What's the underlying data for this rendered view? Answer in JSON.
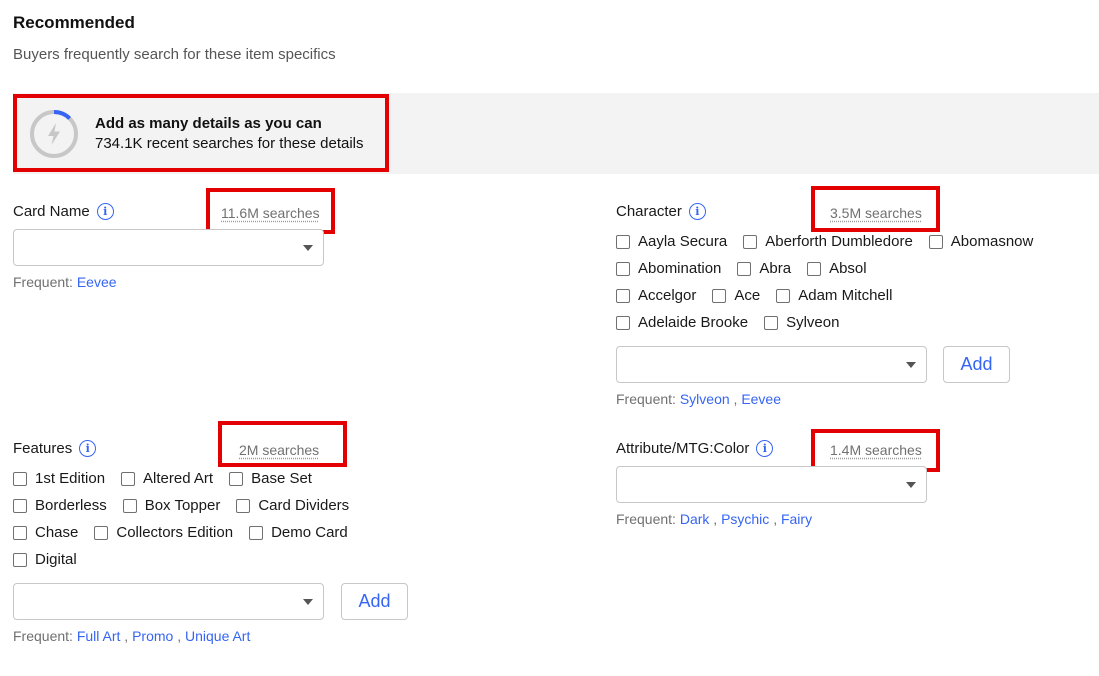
{
  "header": {
    "title": "Recommended",
    "subtitle": "Buyers frequently search for these item specifics"
  },
  "banner": {
    "heading": "Add as many details as you can",
    "subtext": "734.1K recent searches for these details",
    "icon": "lightning-gauge-icon",
    "progress": 0.12
  },
  "card_name": {
    "label": "Card Name",
    "searches": "11.6M searches",
    "frequent_label": "Frequent:",
    "frequent": [
      "Eevee"
    ]
  },
  "character": {
    "label": "Character",
    "searches": "3.5M searches",
    "rows": [
      [
        "Aayla Secura",
        "Aberforth Dumbledore",
        "Abomasnow"
      ],
      [
        "Abomination",
        "Abra",
        "Absol"
      ],
      [
        "Accelgor",
        "Ace",
        "Adam Mitchell"
      ],
      [
        "Adelaide Brooke",
        "Sylveon"
      ]
    ],
    "add_label": "Add",
    "frequent_label": "Frequent:",
    "frequent": [
      "Sylveon",
      "Eevee"
    ]
  },
  "features": {
    "label": "Features",
    "searches": "2M searches",
    "rows": [
      [
        "1st Edition",
        "Altered Art",
        "Base Set"
      ],
      [
        "Borderless",
        "Box Topper",
        "Card Dividers"
      ],
      [
        "Chase",
        "Collectors Edition",
        "Demo Card"
      ],
      [
        "Digital"
      ]
    ],
    "add_label": "Add",
    "frequent_label": "Frequent:",
    "frequent": [
      "Full Art",
      "Promo",
      "Unique Art"
    ]
  },
  "color": {
    "label": "Attribute/MTG:Color",
    "searches": "1.4M searches",
    "frequent_label": "Frequent:",
    "frequent": [
      "Dark",
      "Psychic",
      "Fairy"
    ]
  },
  "colors": {
    "link": "#3665f3",
    "highlight": "#e30000",
    "banner_bg": "#f3f3f3"
  }
}
